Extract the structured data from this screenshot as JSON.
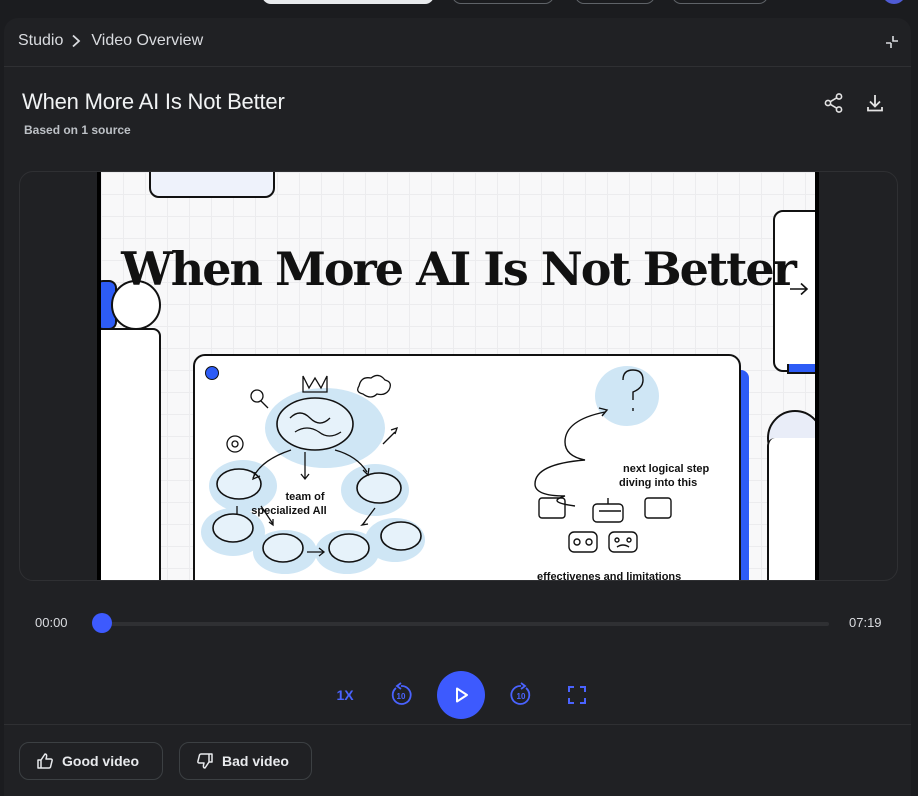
{
  "breadcrumb": {
    "root": "Studio",
    "current": "Video Overview"
  },
  "header": {
    "title": "When More AI Is Not Better",
    "subtitle": "Based on 1 source"
  },
  "slide": {
    "title": "When More AI Is Not Better",
    "label_team": "team of",
    "label_specialized": "specialized All",
    "label_next": "next logical step",
    "label_diving": "diving into this",
    "label_effect": "effectivenes and limitations"
  },
  "player": {
    "current_time": "00:00",
    "duration": "07:19",
    "progress_fraction": 0.0,
    "speed_label": "1X",
    "rewind_seconds": "10",
    "forward_seconds": "10"
  },
  "feedback": {
    "good_label": "Good video",
    "bad_label": "Bad video"
  },
  "colors": {
    "accent": "#3d5afe",
    "slide_blue": "#2d5cf6",
    "panel_bg": "#202124"
  },
  "icons": [
    "collapse-icon",
    "share-icon",
    "download-icon",
    "play-icon",
    "rewind-10-icon",
    "forward-10-icon",
    "fullscreen-icon",
    "thumbs-up-icon",
    "thumbs-down-icon",
    "arrow-right-icon"
  ]
}
